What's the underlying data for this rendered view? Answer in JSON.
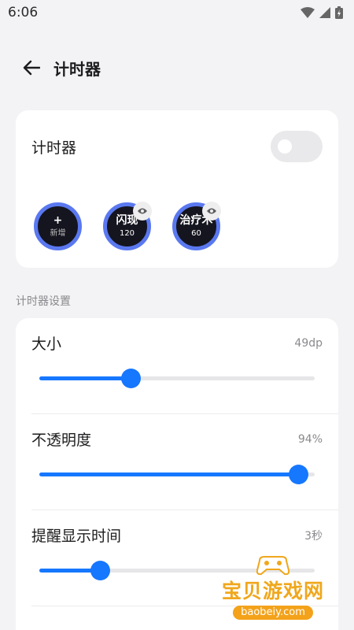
{
  "status_bar": {
    "time": "6:06",
    "icons": [
      "wifi-icon",
      "signal-icon",
      "battery-icon"
    ]
  },
  "app_bar": {
    "back_icon": "arrow-left-icon",
    "title": "计时器"
  },
  "timer_card": {
    "title": "计时器",
    "enabled": false,
    "add": {
      "plus": "+",
      "label": "新增"
    },
    "timers": [
      {
        "name": "闪现",
        "seconds": "120"
      },
      {
        "name": "治疗术",
        "seconds": "60"
      }
    ]
  },
  "settings_section": {
    "label": "计时器设置",
    "items": [
      {
        "label": "大小",
        "value": "49dp",
        "fraction": 0.33
      },
      {
        "label": "不透明度",
        "value": "94%",
        "fraction": 0.94
      },
      {
        "label": "提醒显示时间",
        "value": "3秒",
        "fraction": 0.22
      }
    ]
  },
  "watermark": {
    "title": "宝贝游戏网",
    "url": "baobeiy.com"
  },
  "colors": {
    "accent": "#1677ff",
    "timer_ring": "#5a78f0",
    "timer_bg": "#14151f",
    "watermark": "#f0a71c"
  }
}
